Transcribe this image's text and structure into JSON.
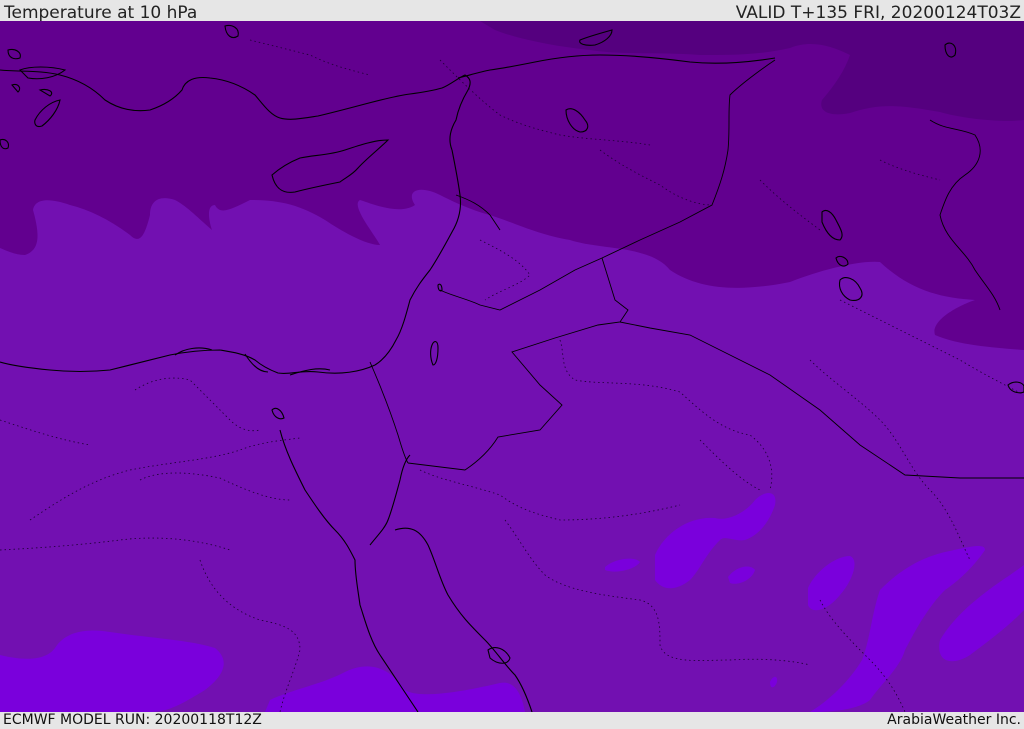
{
  "header": {
    "title": "Temperature at 10 hPa",
    "valid_time": "VALID T+135 FRI, 20200124T03Z"
  },
  "footer": {
    "model_run": "ECMWF MODEL RUN: 20200118T12Z",
    "credit": "ArabiaWeather Inc."
  },
  "colors": {
    "band_darkest": "#55007f",
    "band_dark": "#62008f",
    "band_medium": "#7210b1",
    "band_light": "#7a00dc",
    "coastline": "#000000"
  }
}
